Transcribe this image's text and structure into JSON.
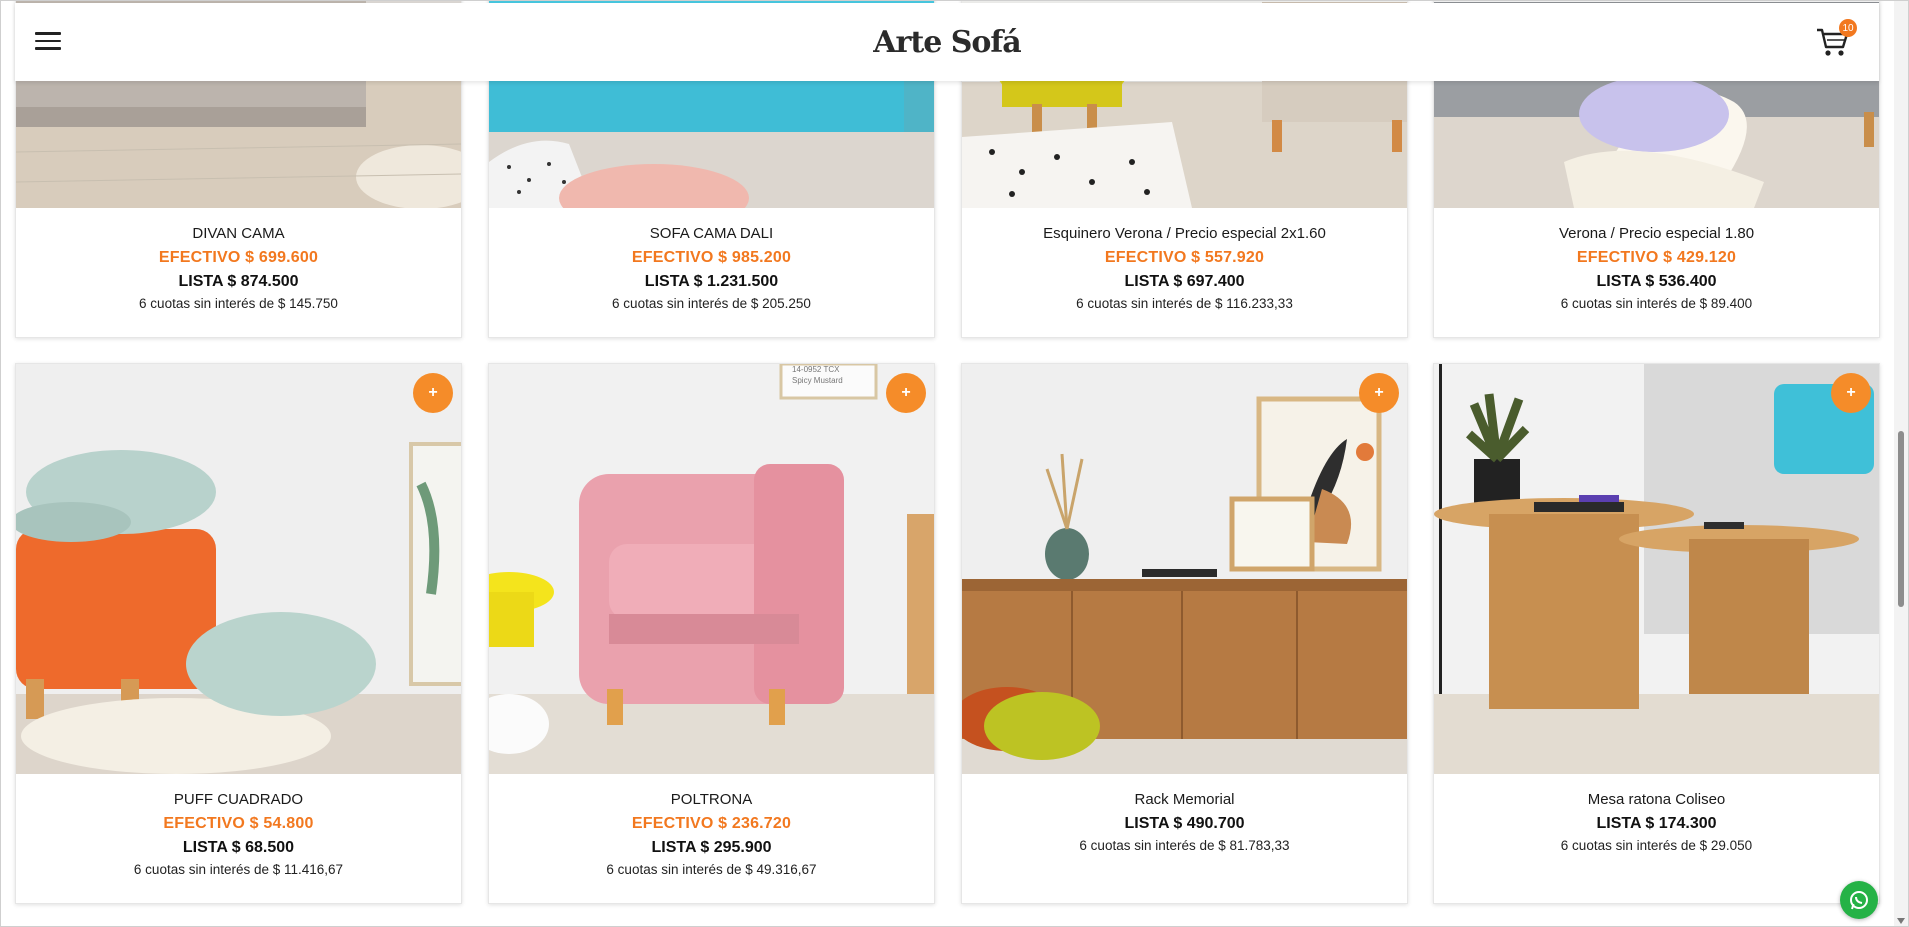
{
  "header": {
    "logo": "Arte Sofá",
    "cart_count": "10"
  },
  "products_top": [
    {
      "name": "DIVAN CAMA",
      "cash": "EFECTIVO $ 699.600",
      "list": "LISTA $ 874.500",
      "cuotas": "6 cuotas sin interés de $ 145.750"
    },
    {
      "name": "SOFA CAMA DALI",
      "cash": "EFECTIVO $ 985.200",
      "list": "LISTA $ 1.231.500",
      "cuotas": "6 cuotas sin interés de $ 205.250"
    },
    {
      "name": "Esquinero Verona / Precio especial 2x1.60",
      "cash": "EFECTIVO $ 557.920",
      "list": "LISTA $ 697.400",
      "cuotas": "6 cuotas sin interés de $ 116.233,33"
    },
    {
      "name": "Verona / Precio especial 1.80",
      "cash": "EFECTIVO $ 429.120",
      "list": "LISTA $ 536.400",
      "cuotas": "6 cuotas sin interés de $ 89.400"
    }
  ],
  "products_bottom": [
    {
      "name": "PUFF CUADRADO",
      "cash": "EFECTIVO $ 54.800",
      "list": "LISTA $ 68.500",
      "cuotas": "6 cuotas sin interés de $ 11.416,67",
      "add": "+"
    },
    {
      "name": "POLTRONA",
      "cash": "EFECTIVO $ 236.720",
      "list": "LISTA $ 295.900",
      "cuotas": "6 cuotas sin interés de $ 49.316,67",
      "add": "+",
      "swatch_text_1": "14-0952 TCX",
      "swatch_text_2": "Spicy Mustard"
    },
    {
      "name": "Rack Memorial",
      "list": "LISTA $ 490.700",
      "cuotas": "6 cuotas sin interés de $ 81.783,33",
      "add": "+"
    },
    {
      "name": "Mesa ratona Coliseo",
      "list": "LISTA $ 174.300",
      "cuotas": "6 cuotas sin interés de $ 29.050",
      "add": "+"
    }
  ],
  "colors": {
    "accent": "#f2781f",
    "whatsapp": "#25b246"
  },
  "icons": {
    "menu": "hamburger-icon",
    "cart": "shopping-cart-icon",
    "add": "plus-icon",
    "chat": "whatsapp-icon"
  }
}
